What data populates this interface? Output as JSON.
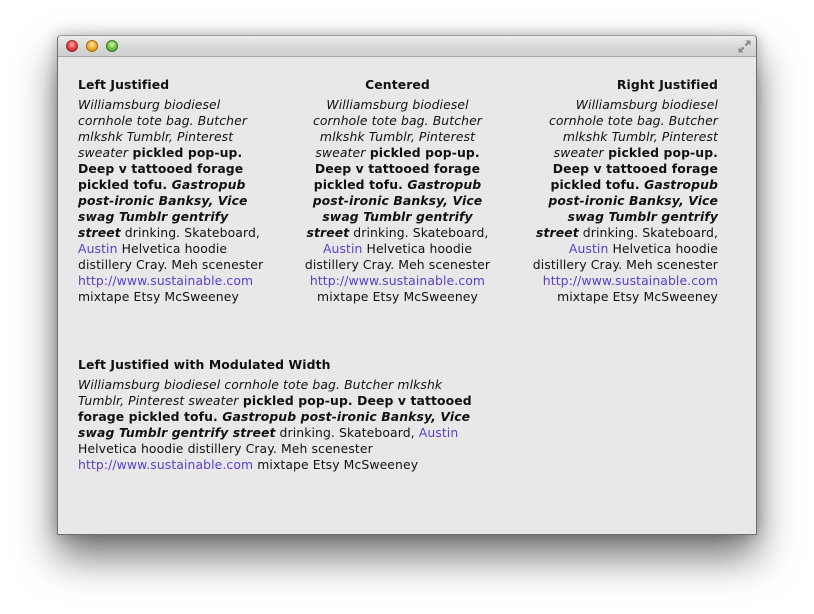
{
  "window": {
    "title": "",
    "controls": [
      "close",
      "minimize",
      "zoom"
    ],
    "fullscreen_icon": "fullscreen-arrows-icon"
  },
  "colors": {
    "link": "#5a3fc8",
    "background": "#e8e8e8",
    "text": "#111111"
  },
  "paragraph": {
    "italic_1": "Williamsburg biodiesel cornhole tote bag. Butcher mlkshk Tumblr, Pinterest sweater",
    "bold_1": " pickled pop-up. Deep v tattooed forage pickled tofu.",
    "bold_italic_1": " Gastropub post-ironic Banksy, Vice swag Tumblr gentrify street",
    "plain_1": " drinking. Skateboard, ",
    "link_1": "Austin",
    "plain_2": " Helvetica hoodie distillery Cray. Meh scenester ",
    "link_2": "http://www.sustainable.com",
    "plain_3": " mixtape Etsy McSweeney"
  },
  "sections": [
    {
      "heading": "Left Justified",
      "align": "left"
    },
    {
      "heading": "Centered",
      "align": "center"
    },
    {
      "heading": "Right Justified",
      "align": "right"
    },
    {
      "heading": "Left Justified with Modulated Width",
      "align": "left"
    }
  ]
}
